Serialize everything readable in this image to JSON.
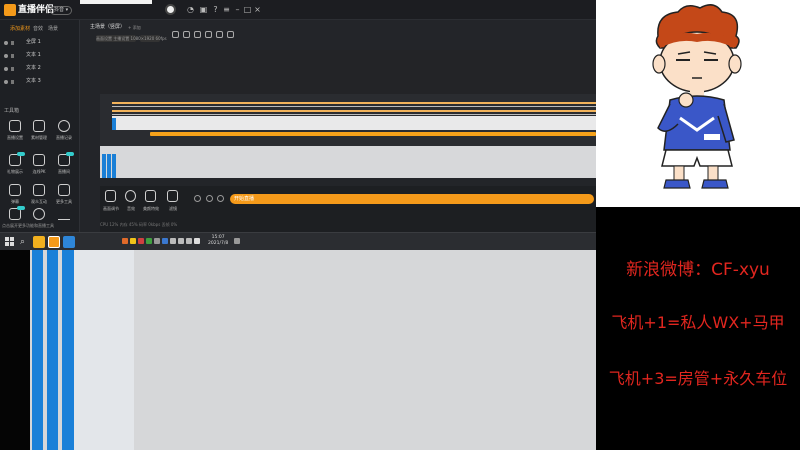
{
  "app": {
    "name": "直播伴侣",
    "version_badge": "抖音 ▾",
    "left_tabs": [
      "添加素材",
      "音效",
      "场景"
    ],
    "sources": [
      "全屏 1",
      "文本 1",
      "文本 2",
      "文本 3"
    ],
    "tools_title": "工具箱",
    "tools": [
      {
        "label": "直播设置",
        "icon": "settings-icon"
      },
      {
        "label": "素材管理",
        "icon": "folder-icon"
      },
      {
        "label": "直播记录",
        "icon": "clock-icon"
      },
      {
        "label": "礼物展示",
        "icon": "gift-icon"
      },
      {
        "label": "连线PK",
        "icon": "link-icon"
      },
      {
        "label": "直播间",
        "icon": "room-icon"
      },
      {
        "label": "弹幕",
        "icon": "chat-icon"
      },
      {
        "label": "观众互动",
        "icon": "user-icon"
      },
      {
        "label": "更多工具",
        "icon": "grid-icon"
      },
      {
        "label": "数据",
        "icon": "chart-icon"
      },
      {
        "label": "粉丝团",
        "icon": "fans-icon"
      },
      {
        "label": "更多",
        "icon": "more-icon"
      }
    ],
    "left_bottom": "点击展开更多功能和直播工具",
    "scene_tab": "主场景（竖屏）",
    "scene_add": "+ 添加",
    "res_text": "画面设置  主播设置  1080×1920 60fps",
    "controls": [
      {
        "label": "画面调节",
        "icon": "adjust-icon"
      },
      {
        "label": "音效",
        "icon": "mic-icon"
      },
      {
        "label": "美颜特效",
        "icon": "beauty-icon"
      },
      {
        "label": "滤镜",
        "icon": "filter-icon"
      }
    ],
    "live_button": "开始直播",
    "footer": "CPU 12%  内存 45%  码率 0kbps  丢帧 0%"
  },
  "taskbar": {
    "time": "15:07",
    "date": "2021/7/8"
  },
  "promo": {
    "line1": "新浪微博：CF-xyu",
    "line2": "飞机+1=私人WX+马甲",
    "line3": "飞机+3=房管+永久车位"
  },
  "colors": {
    "accent_orange": "#f59a1a",
    "promo_red": "#e1261f",
    "blue": "#1a80d8",
    "shirt_blue": "#3a57c8"
  }
}
